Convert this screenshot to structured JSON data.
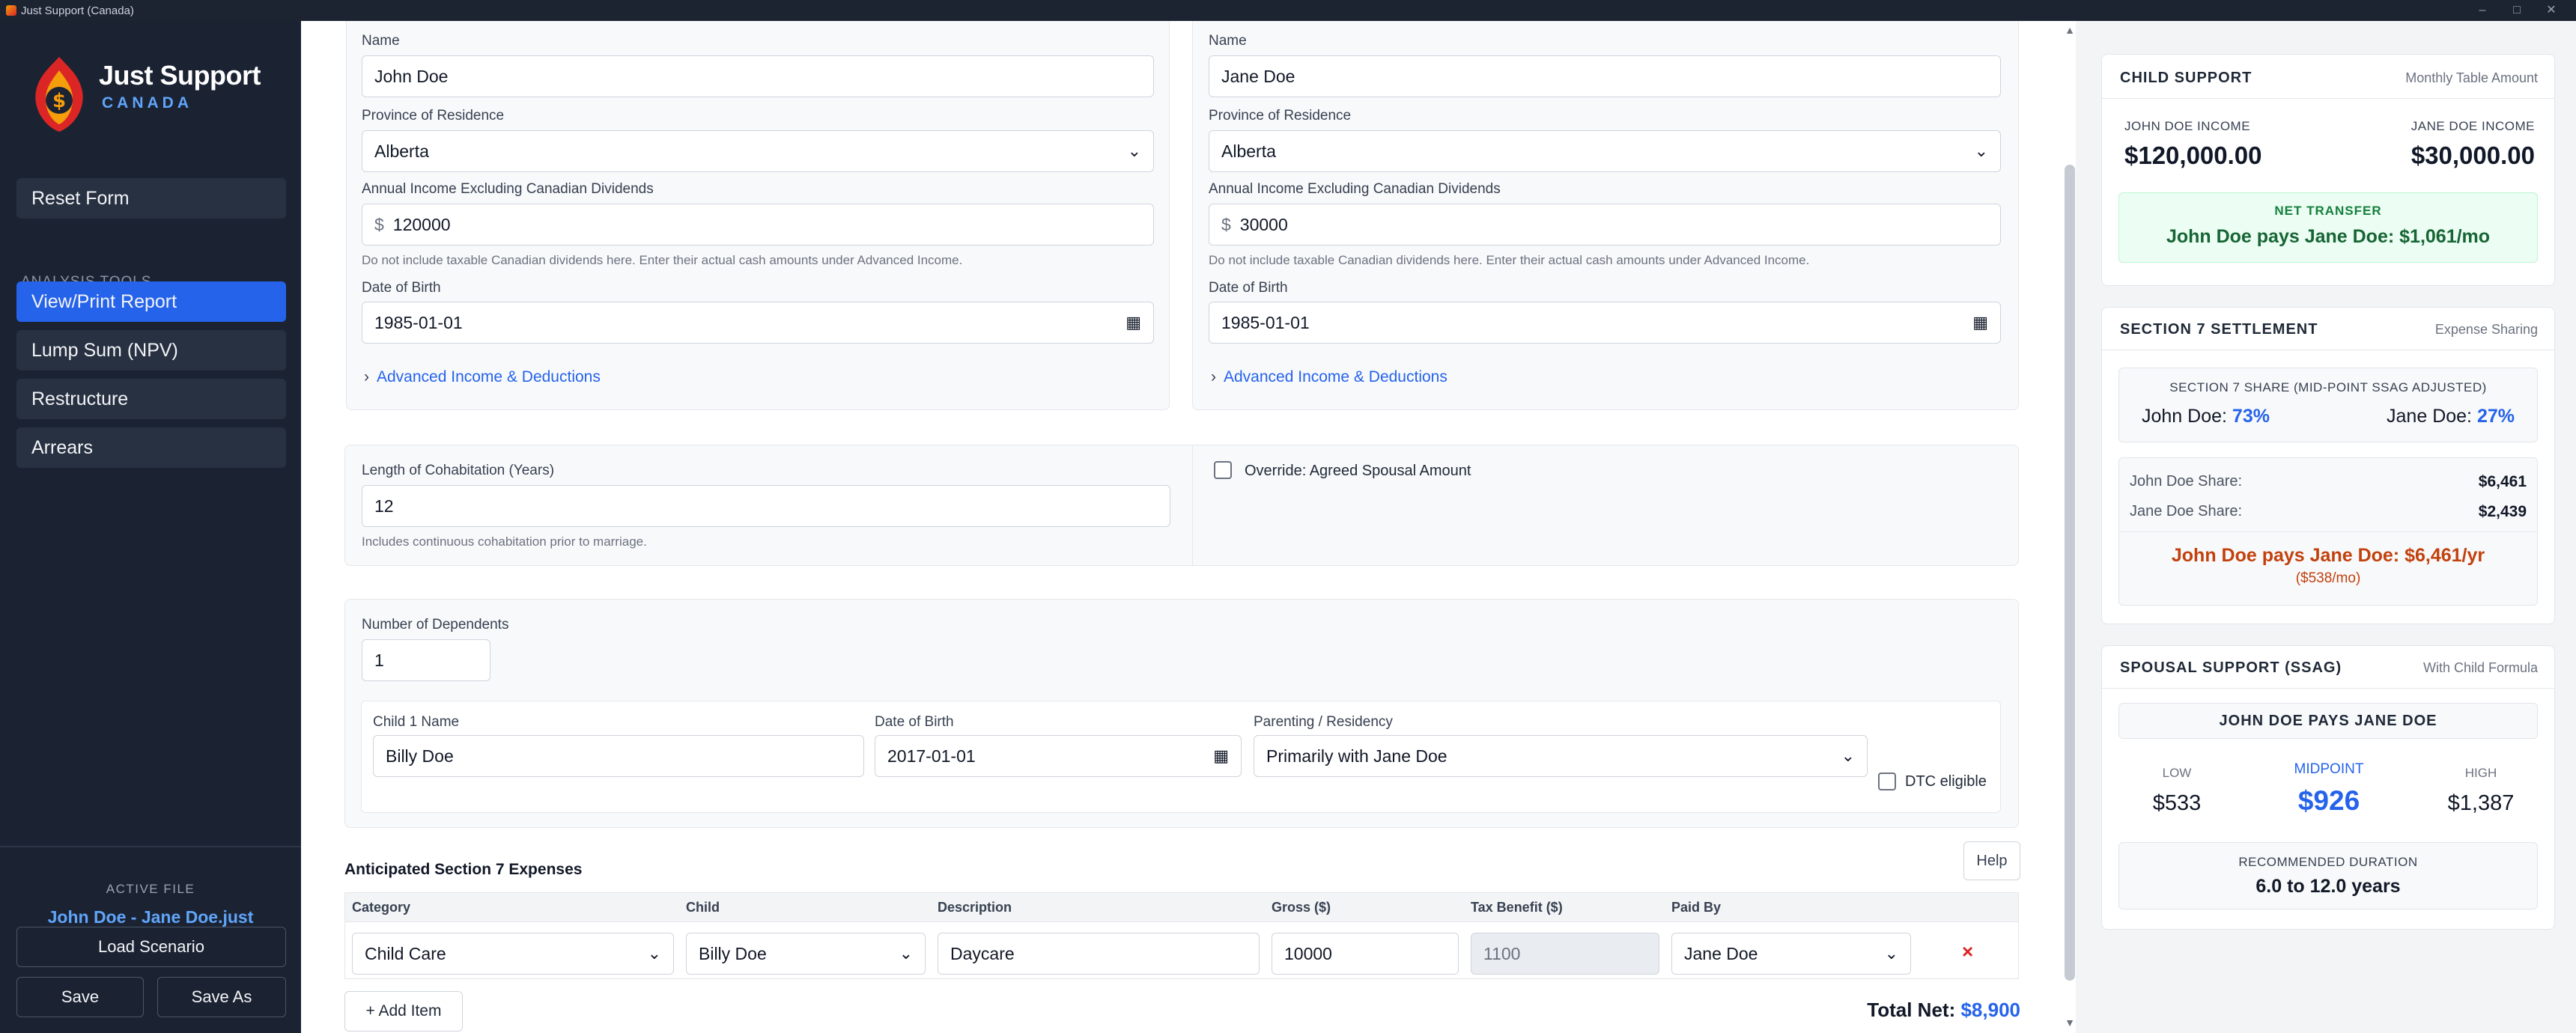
{
  "window": {
    "title": "Just Support (Canada)"
  },
  "sidebar": {
    "brand_title": "Just Support",
    "brand_sub": "CANADA",
    "reset_label": "Reset Form",
    "section_label": "ANALYSIS TOOLS",
    "items": [
      {
        "label": "View/Print Report"
      },
      {
        "label": "Lump Sum (NPV)"
      },
      {
        "label": "Restructure"
      },
      {
        "label": "Arrears"
      }
    ],
    "active_file_label": "ACTIVE FILE",
    "active_file_name": "John Doe - Jane Doe.just",
    "load_label": "Load Scenario",
    "save_label": "Save",
    "save_as_label": "Save As"
  },
  "parties": [
    {
      "name_label": "Name",
      "name_value": "John Doe",
      "province_label": "Province of Residence",
      "province_value": "Alberta",
      "income_label": "Annual Income Excluding Canadian Dividends",
      "currency": "$",
      "income_value": "120000",
      "income_hint": "Do not include taxable Canadian dividends here. Enter their actual cash amounts under Advanced Income.",
      "dob_label": "Date of Birth",
      "dob_value": "1985-01-01",
      "advanced_label": "Advanced Income & Deductions"
    },
    {
      "name_label": "Name",
      "name_value": "Jane Doe",
      "province_label": "Province of Residence",
      "province_value": "Alberta",
      "income_label": "Annual Income Excluding Canadian Dividends",
      "currency": "$",
      "income_value": "30000",
      "income_hint": "Do not include taxable Canadian dividends here. Enter their actual cash amounts under Advanced Income.",
      "dob_label": "Date of Birth",
      "dob_value": "1985-01-01",
      "advanced_label": "Advanced Income & Deductions"
    }
  ],
  "cohabitation": {
    "label": "Length of Cohabitation (Years)",
    "value": "12",
    "hint": "Includes continuous cohabitation prior to marriage.",
    "override_label": "Override: Agreed Spousal Amount"
  },
  "dependents": {
    "label": "Number of Dependents",
    "value": "1",
    "child": {
      "name_label": "Child 1 Name",
      "name_value": "Billy Doe",
      "dob_label": "Date of Birth",
      "dob_value": "2017-01-01",
      "parenting_label": "Parenting / Residency",
      "parenting_value": "Primarily with Jane Doe",
      "dtc_label": "DTC eligible"
    }
  },
  "expenses": {
    "title": "Anticipated Section 7 Expenses",
    "help_label": "Help",
    "headers": [
      "Category",
      "Child",
      "Description",
      "Gross ($)",
      "Tax Benefit ($)",
      "Paid By"
    ],
    "row": {
      "category": "Child Care",
      "child": "Billy Doe",
      "description": "Daycare",
      "gross": "10000",
      "tax_benefit": "1100",
      "paid_by": "Jane Doe",
      "delete": "×"
    },
    "add_label": "+ Add Item",
    "total_label": "Total Net:",
    "total_value": "$8,900"
  },
  "child_support": {
    "title": "CHILD SUPPORT",
    "tag": "Monthly Table Amount",
    "payer_income_label": "JOHN DOE INCOME",
    "payer_income": "$120,000.00",
    "payee_income_label": "JANE DOE INCOME",
    "payee_income": "$30,000.00",
    "net_label": "NET TRANSFER",
    "net_value": "John Doe pays Jane Doe: $1,061/mo"
  },
  "section7": {
    "title": "SECTION 7 SETTLEMENT",
    "tag": "Expense Sharing",
    "share_label": "SECTION 7 SHARE (MID-POINT SSAG ADJUSTED)",
    "john_label": "John Doe:",
    "john_pct": "73%",
    "jane_label": "Jane Doe:",
    "jane_pct": "27%",
    "john_share_label": "John Doe Share:",
    "john_share": "$6,461",
    "jane_share_label": "Jane Doe Share:",
    "jane_share": "$2,439",
    "result": "John Doe pays Jane Doe: $6,461/yr",
    "result_sub": "($538/mo)"
  },
  "spousal": {
    "title": "SPOUSAL SUPPORT (SSAG)",
    "tag": "With Child Formula",
    "direction": "JOHN DOE PAYS JANE DOE",
    "low_label": "LOW",
    "low": "$533",
    "mid_label": "MIDPOINT",
    "mid": "$926",
    "high_label": "HIGH",
    "high": "$1,387",
    "duration_label": "RECOMMENDED DURATION",
    "duration": "6.0 to 12.0 years"
  },
  "colors": {
    "accent": "#2563eb",
    "sidebar_bg": "#1b2333",
    "green": "#15803d",
    "orange": "#c2410c",
    "delete": "#dc2626"
  },
  "icons": [
    "calendar-icon",
    "chevron-down-icon",
    "chevron-right-icon",
    "close-icon",
    "logo-icon"
  ]
}
